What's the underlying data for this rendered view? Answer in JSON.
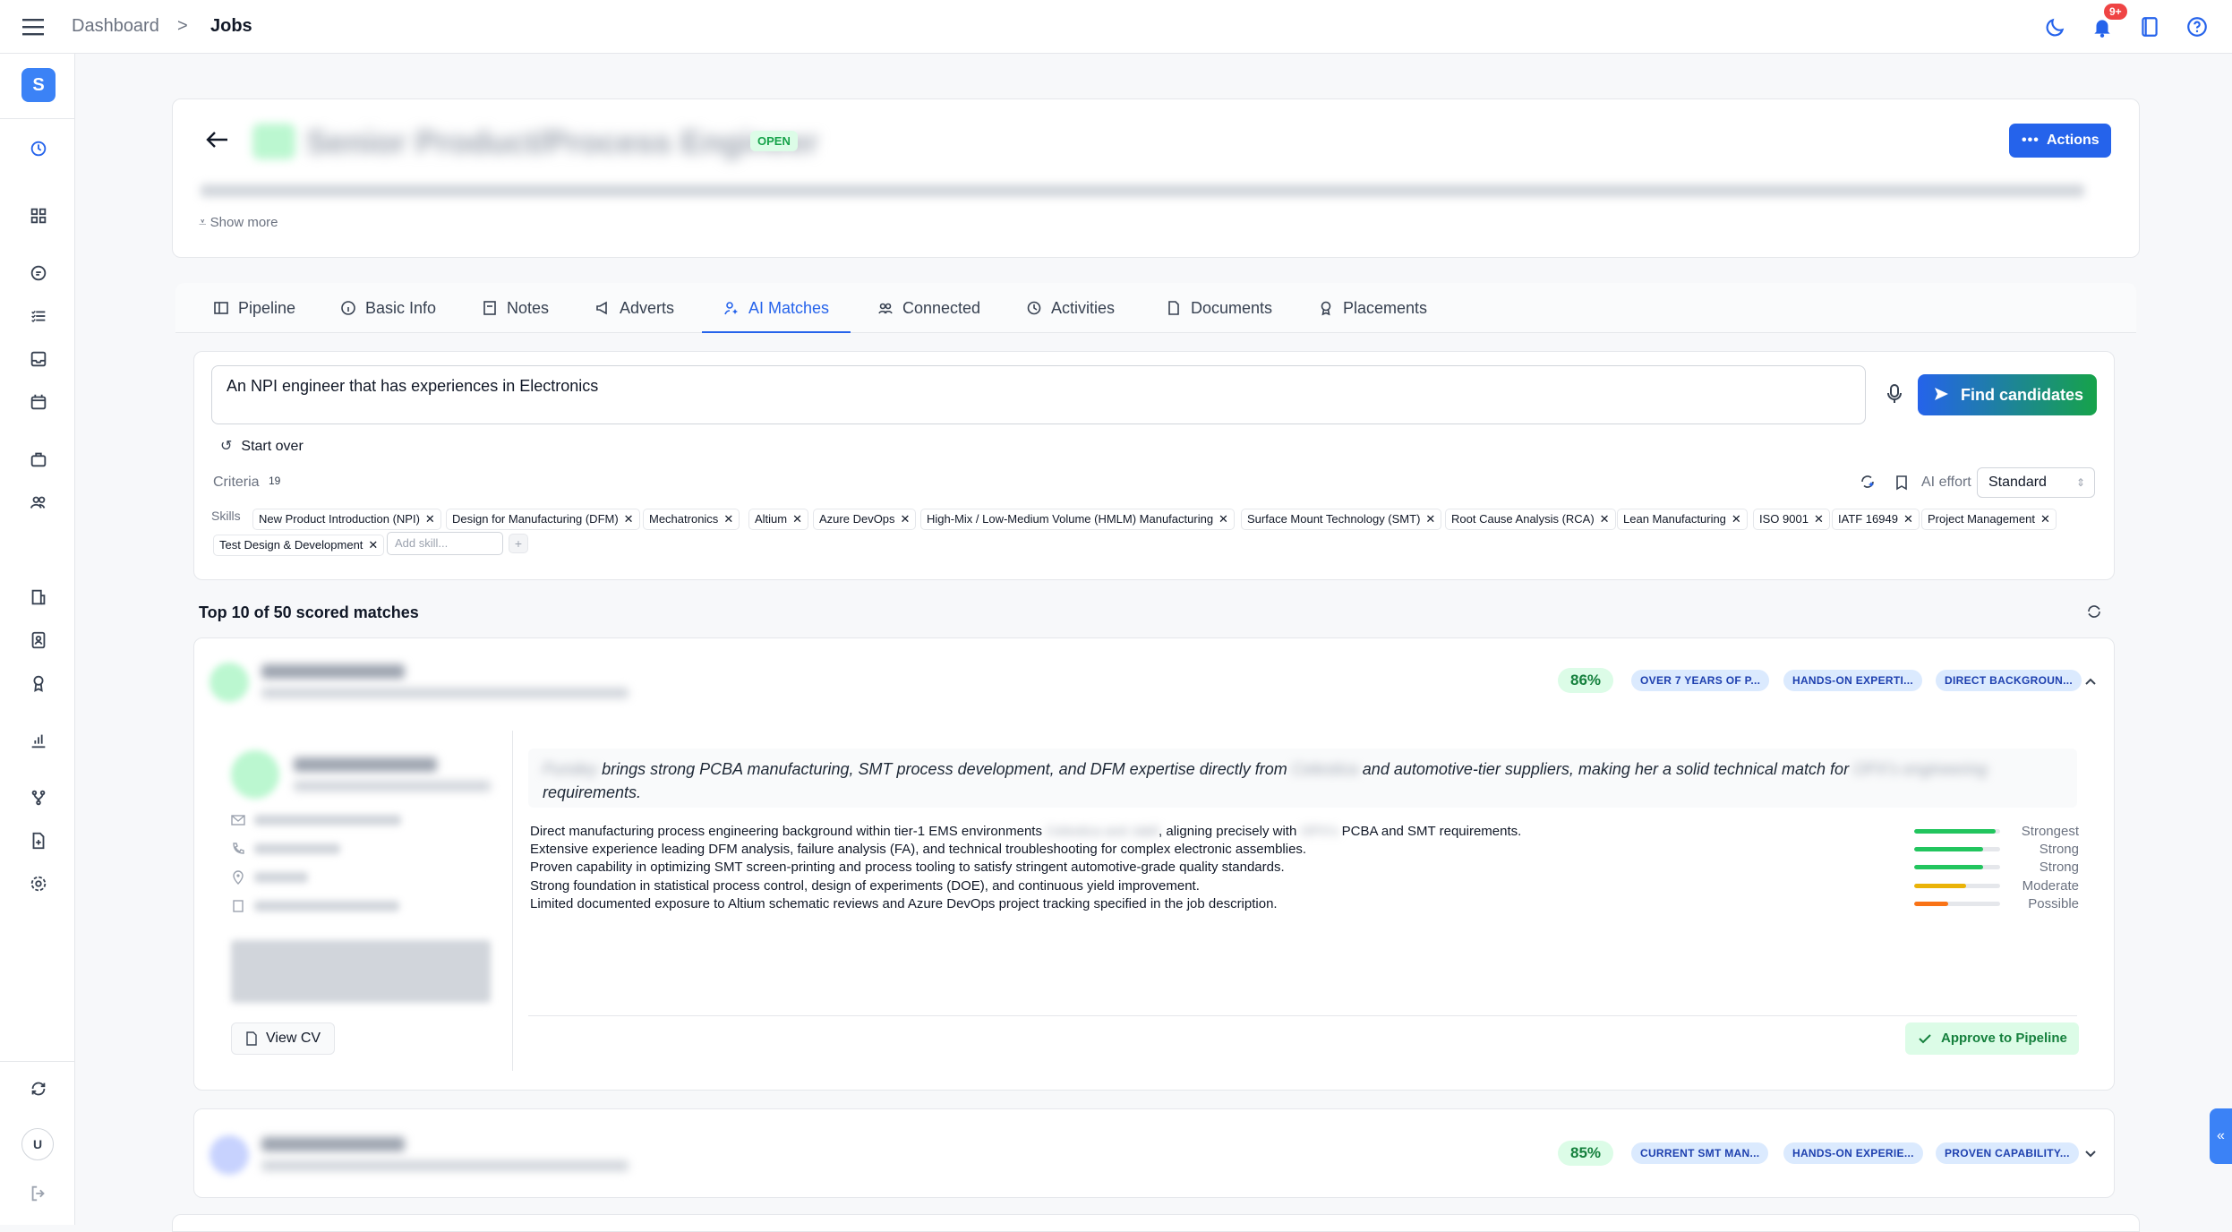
{
  "topbar": {
    "breadcrumb_parent": "Dashboard",
    "breadcrumb_separator": ">",
    "breadcrumb_current": "Jobs",
    "notification_count": "9+",
    "icons": [
      "menu-icon",
      "moon-icon",
      "bell-icon",
      "book-icon",
      "help-icon"
    ]
  },
  "sidebar": {
    "logo_letter": "S",
    "user_initial": "U",
    "icons": [
      "history-icon",
      "grid-icon",
      "chat-icon",
      "list-icon",
      "inbox-icon",
      "calendar-icon",
      "briefcase-icon",
      "users-icon",
      "building-icon",
      "contact-icon",
      "award-icon",
      "chart-icon",
      "branch-icon",
      "file-icon",
      "gear-icon",
      "sync-icon",
      "logout-icon"
    ]
  },
  "job": {
    "status": "OPEN",
    "actions_label": "Actions",
    "show_more": "Show more"
  },
  "tabs": [
    {
      "label": "Pipeline"
    },
    {
      "label": "Basic Info"
    },
    {
      "label": "Notes"
    },
    {
      "label": "Adverts"
    },
    {
      "label": "AI Matches",
      "active": true
    },
    {
      "label": "Connected"
    },
    {
      "label": "Activities"
    },
    {
      "label": "Documents"
    },
    {
      "label": "Placements"
    }
  ],
  "search": {
    "query": "An NPI engineer that has experiences in Electronics",
    "find_button": "Find candidates",
    "start_over": "Start over",
    "criteria_label": "Criteria",
    "criteria_count": "19",
    "ai_effort_label": "AI effort",
    "ai_effort_value": "Standard",
    "skills_label": "Skills",
    "add_skill_placeholder": "Add skill...",
    "skills": [
      "New Product Introduction (NPI)",
      "Design for Manufacturing (DFM)",
      "Mechatronics",
      "Altium",
      "Azure DevOps",
      "High-Mix / Low-Medium Volume (HMLM) Manufacturing",
      "Surface Mount Technology (SMT)",
      "Root Cause Analysis (RCA)",
      "Lean Manufacturing",
      "ISO 9001",
      "IATF 16949",
      "Project Management",
      "Test Design & Development"
    ]
  },
  "results": {
    "heading": "Top 10 of 50 scored matches",
    "matches": [
      {
        "score": "86%",
        "tags": [
          "OVER 7 YEARS OF P...",
          "HANDS-ON EXPERTI...",
          "DIRECT BACKGROUN..."
        ],
        "expanded": true,
        "summary_part1": "brings strong PCBA manufacturing, SMT process development, and DFM expertise directly from",
        "summary_part2": "and automotive-tier suppliers, making her a solid technical match for",
        "summary_part3": "requirements.",
        "reasons": [
          {
            "text_a": "Direct manufacturing process engineering background within tier-1 EMS environments",
            "text_b": "aligning precisely with",
            "text_c": "PCBA and SMT requirements.",
            "strength": "Strongest",
            "level": 0.95,
            "color": "#22c55e"
          },
          {
            "text_a": "Extensive experience leading DFM analysis, failure analysis (FA), and technical troubleshooting for complex electronic assemblies.",
            "strength": "Strong",
            "level": 0.8,
            "color": "#22c55e"
          },
          {
            "text_a": "Proven capability in optimizing SMT screen-printing and process tooling to satisfy stringent automotive-grade quality standards.",
            "strength": "Strong",
            "level": 0.8,
            "color": "#22c55e"
          },
          {
            "text_a": "Strong foundation in statistical process control, design of experiments (DOE), and continuous yield improvement.",
            "strength": "Moderate",
            "level": 0.6,
            "color": "#eab308"
          },
          {
            "text_a": "Limited documented exposure to Altium schematic reviews and Azure DevOps project tracking specified in the job description.",
            "strength": "Possible",
            "level": 0.4,
            "color": "#f97316"
          }
        ],
        "view_cv": "View CV",
        "approve": "Approve to Pipeline"
      },
      {
        "score": "85%",
        "tags": [
          "CURRENT SMT MAN...",
          "HANDS-ON EXPERIE...",
          "PROVEN CAPABILITY..."
        ],
        "expanded": false
      }
    ]
  },
  "colors": {
    "primary": "#2563eb",
    "success": "#16a34a",
    "badge_bg": "#dcfce7",
    "tag_bg": "#dbeafe"
  }
}
